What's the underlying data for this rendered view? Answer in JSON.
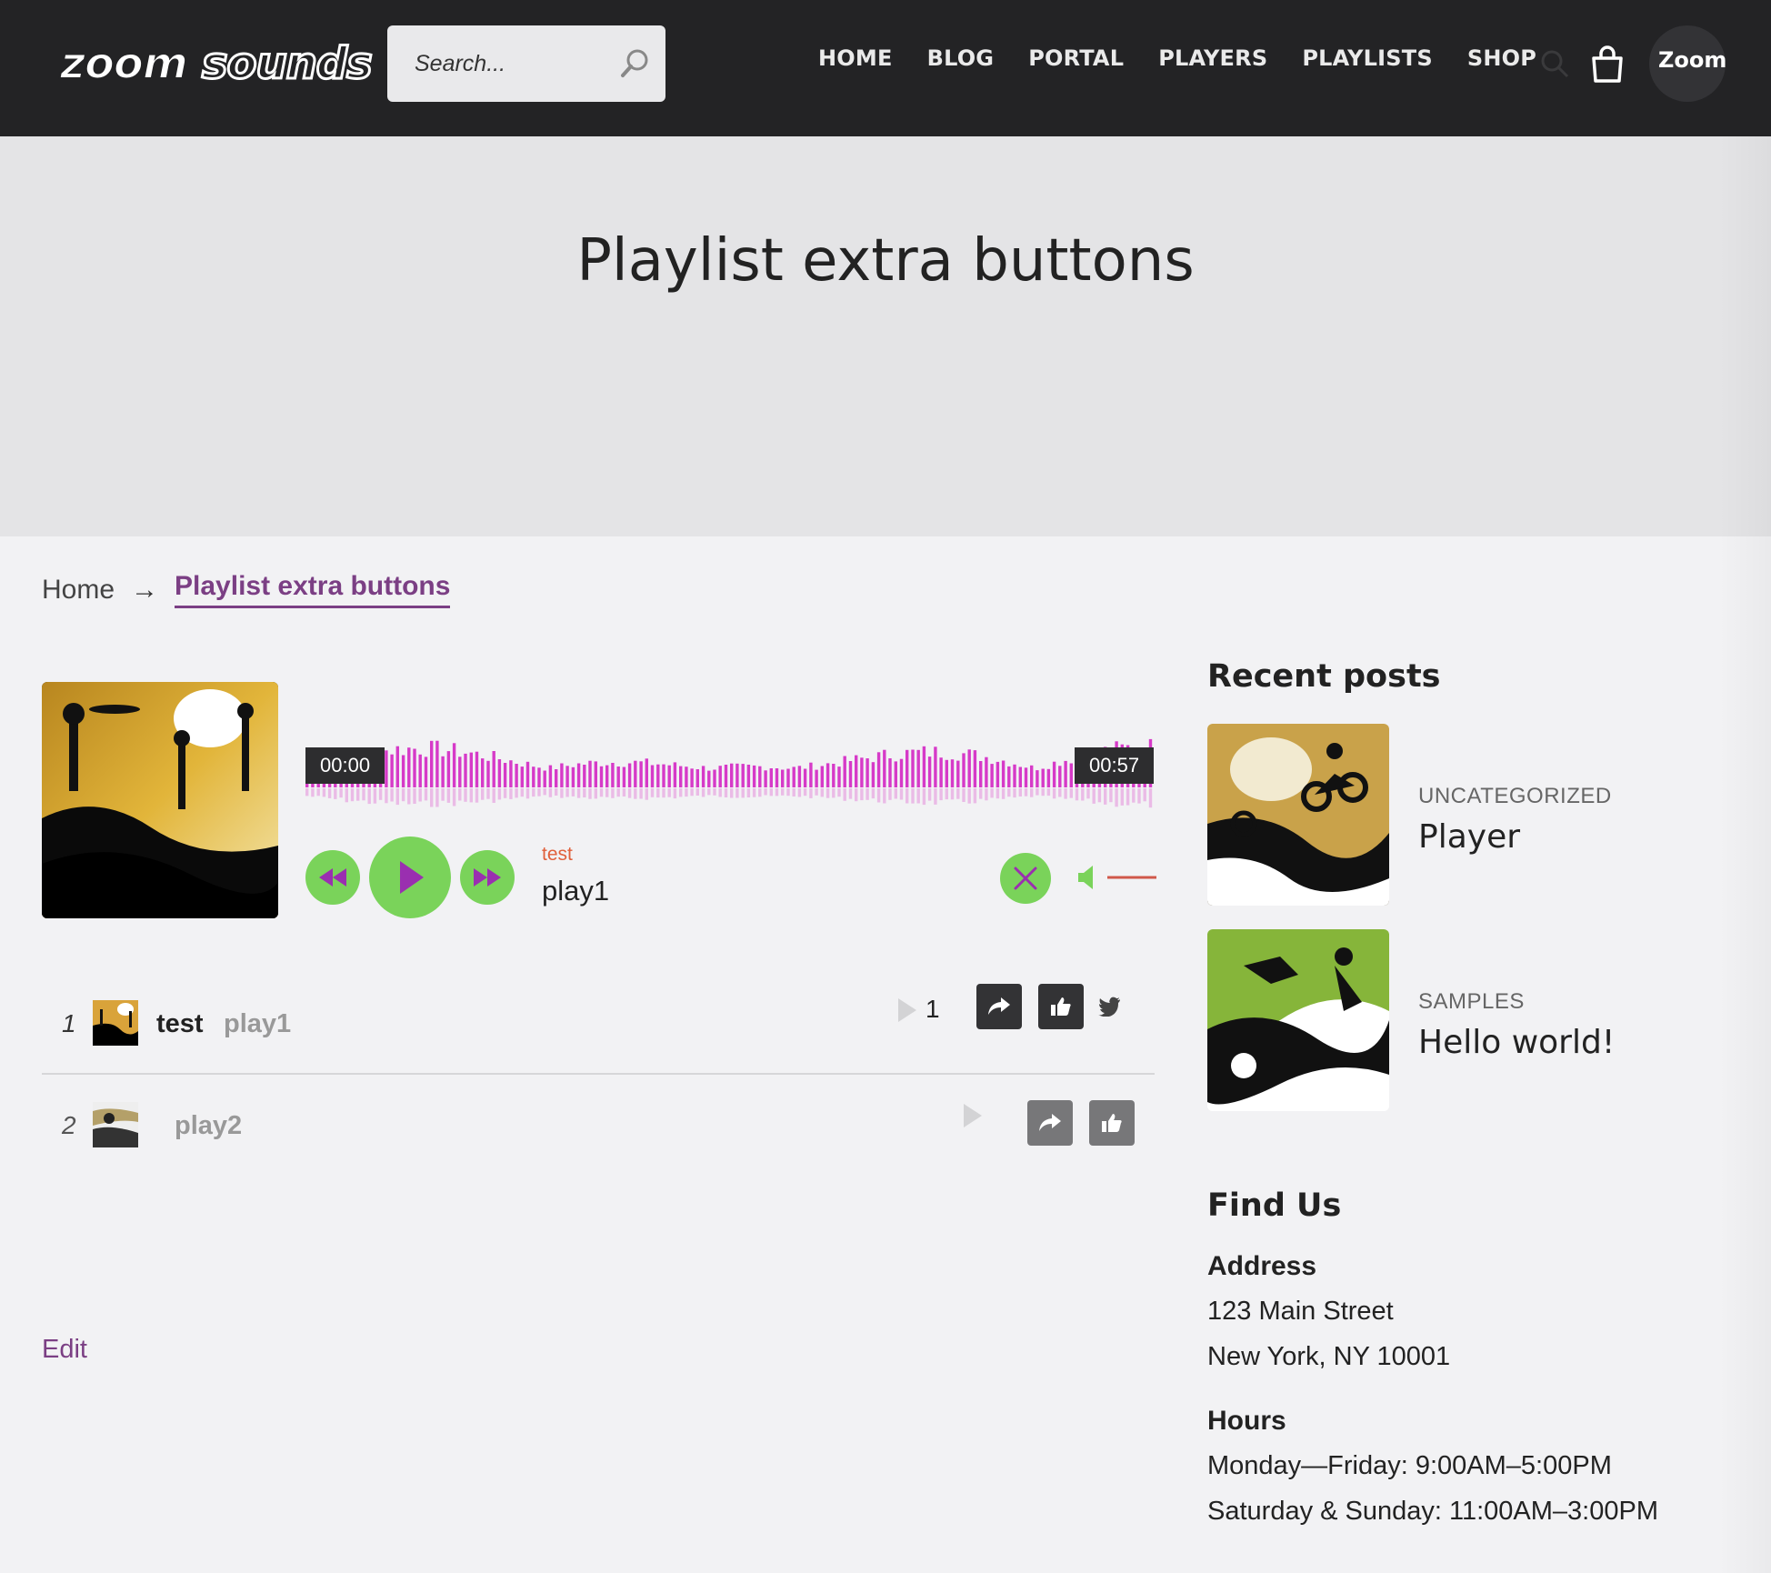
{
  "header": {
    "logo_left": "zoom",
    "logo_right": "sounds",
    "search_placeholder": "Search...",
    "nav": [
      "HOME",
      "BLOG",
      "PORTAL",
      "PLAYERS",
      "PLAYLISTS",
      "SHOP"
    ],
    "avatar_text": "Zoom"
  },
  "hero": {
    "title": "Playlist extra buttons"
  },
  "breadcrumb": {
    "home": "Home",
    "arrow": "→",
    "current": "Playlist extra buttons"
  },
  "player": {
    "time_current": "00:00",
    "time_total": "00:57",
    "artist": "test",
    "title": "play1",
    "progress": 0
  },
  "playlist": [
    {
      "number": "1",
      "artist": "test",
      "title": "play1",
      "play_count": "1"
    },
    {
      "number": "2",
      "artist": "",
      "title": "play2"
    }
  ],
  "edit_label": "Edit",
  "sidebar": {
    "recent_heading": "Recent posts",
    "posts": [
      {
        "category": "UNCATEGORIZED",
        "title": "Player"
      },
      {
        "category": "SAMPLES",
        "title": "Hello world!"
      }
    ],
    "find_heading": "Find Us",
    "address_heading": "Address",
    "address_line1": "123 Main Street",
    "address_line2": "New York, NY 10001",
    "hours_heading": "Hours",
    "hours_line1": "Monday—Friday: 9:00AM–5:00PM",
    "hours_line2": "Saturday & Sunday: 11:00AM–3:00PM"
  },
  "colors": {
    "header_bg": "#232325",
    "accent_purple": "#7b3f84",
    "control_green": "#7ad35a",
    "waveform_magenta": "#d63ac8",
    "artist_orange": "#e0603b"
  }
}
